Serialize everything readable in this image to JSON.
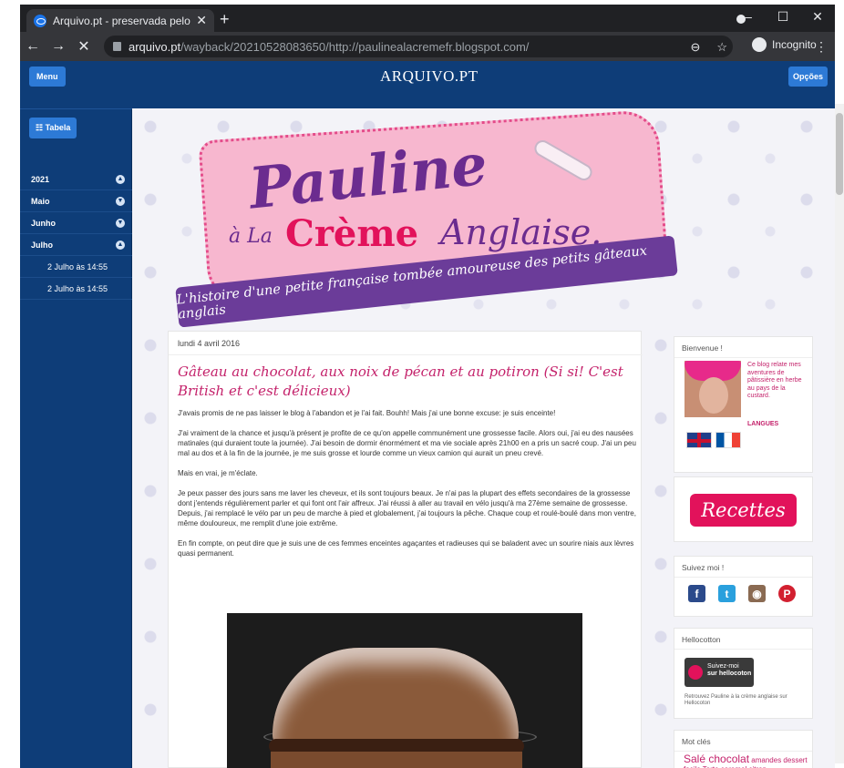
{
  "browser": {
    "tab_title": "Arquivo.pt - preservada pelo Arq",
    "new_tab": "+",
    "url_host": "arquivo.pt",
    "url_path": "/wayback/20210528083650/http://paulinealacremefr.blogspot.com/",
    "incognito_label": "Incognito",
    "win_min": "–",
    "win_max": "☐",
    "win_close": "✕"
  },
  "arquivo": {
    "menu_label": "Menu",
    "logo": "ARQUIVO.PT",
    "options_label": "Opções",
    "tabela_label": "☷ Tabela",
    "tree": [
      {
        "label": "2021"
      },
      {
        "label": "Maio"
      },
      {
        "label": "Junho"
      },
      {
        "label": "Julho"
      },
      {
        "label": "2 Julho às 14:55"
      },
      {
        "label": "2 Julho às 14:55"
      }
    ]
  },
  "banner": {
    "pauline": "Pauline",
    "ala": "à La",
    "creme": "Crème",
    "anglaise": "Anglaise.",
    "ribbon": "L'histoire d'une petite française tombée amoureuse des petits gâteaux anglais"
  },
  "post": {
    "date": "lundi 4 avril 2016",
    "title": "Gâteau au chocolat, aux noix de pécan et au potiron (Si si! C'est British et c'est délicieux)",
    "paragraphs": [
      "J'avais promis de ne pas laisser le blog à l'abandon et je l'ai fait. Bouhh! Mais j'ai une bonne excuse: je suis enceinte!",
      "J'ai vraiment de la chance et jusqu'à présent je profite de ce qu'on appelle communément une grossesse facile. Alors oui, j'ai eu des nausées matinales (qui duraient toute la journée). J'ai besoin de dormir énormément et ma vie sociale après 21h00 en a pris un sacré coup. J'ai un peu mal au dos et à la fin de la journée, je me suis grosse et lourde comme un vieux camion qui aurait un pneu crevé.",
      "Mais en vrai, je m'éclate.",
      "Je peux passer des jours sans me laver les cheveux, et ils sont toujours beaux. Je n'ai pas la plupart des effets secondaires de la grossesse dont j'entends régulièrement parler et qui font ont l'air affreux. J'ai réussi à aller au travail en vélo jusqu'à ma 27ème semaine de grossesse. Depuis, j'ai remplacé le vélo par un peu de marche à pied et globalement, j'ai toujours la pêche. Chaque coup et roulé-boulé dans mon ventre, même douloureux, me remplit d'une joie extrême.",
      "En fin compte, on peut dire que je suis une de ces femmes enceintes agaçantes et radieuses qui se baladent avec un sourire niais aux lèvres quasi permanent."
    ]
  },
  "widgets": {
    "bienvenue_title": "Bienvenue !",
    "bio": "Ce blog relate mes aventures de pâtissière en herbe au pays de la custard.",
    "langues": "LANGUES",
    "recettes": "Recettes",
    "suivez_title": "Suivez moi !",
    "social": [
      "f",
      "t",
      "◉",
      "P"
    ],
    "hello_title": "Hellocotton",
    "hello_line1": "Suivez-moi",
    "hello_line2": "sur hellocoton",
    "hello_note": "Retrouvez Pauline à la crème anglaise sur Hellocoton",
    "motscles_title": "Mot clés",
    "tags_big": "Salé   chocolat",
    "tags_rest": "amandes dessert facile Tarte caramel citron"
  },
  "colors": {
    "arquivo_blue": "#0e3d78",
    "button_blue": "#2d7ad6",
    "accent_pink": "#c4226b",
    "ribbon_purple": "#6b3c99"
  }
}
